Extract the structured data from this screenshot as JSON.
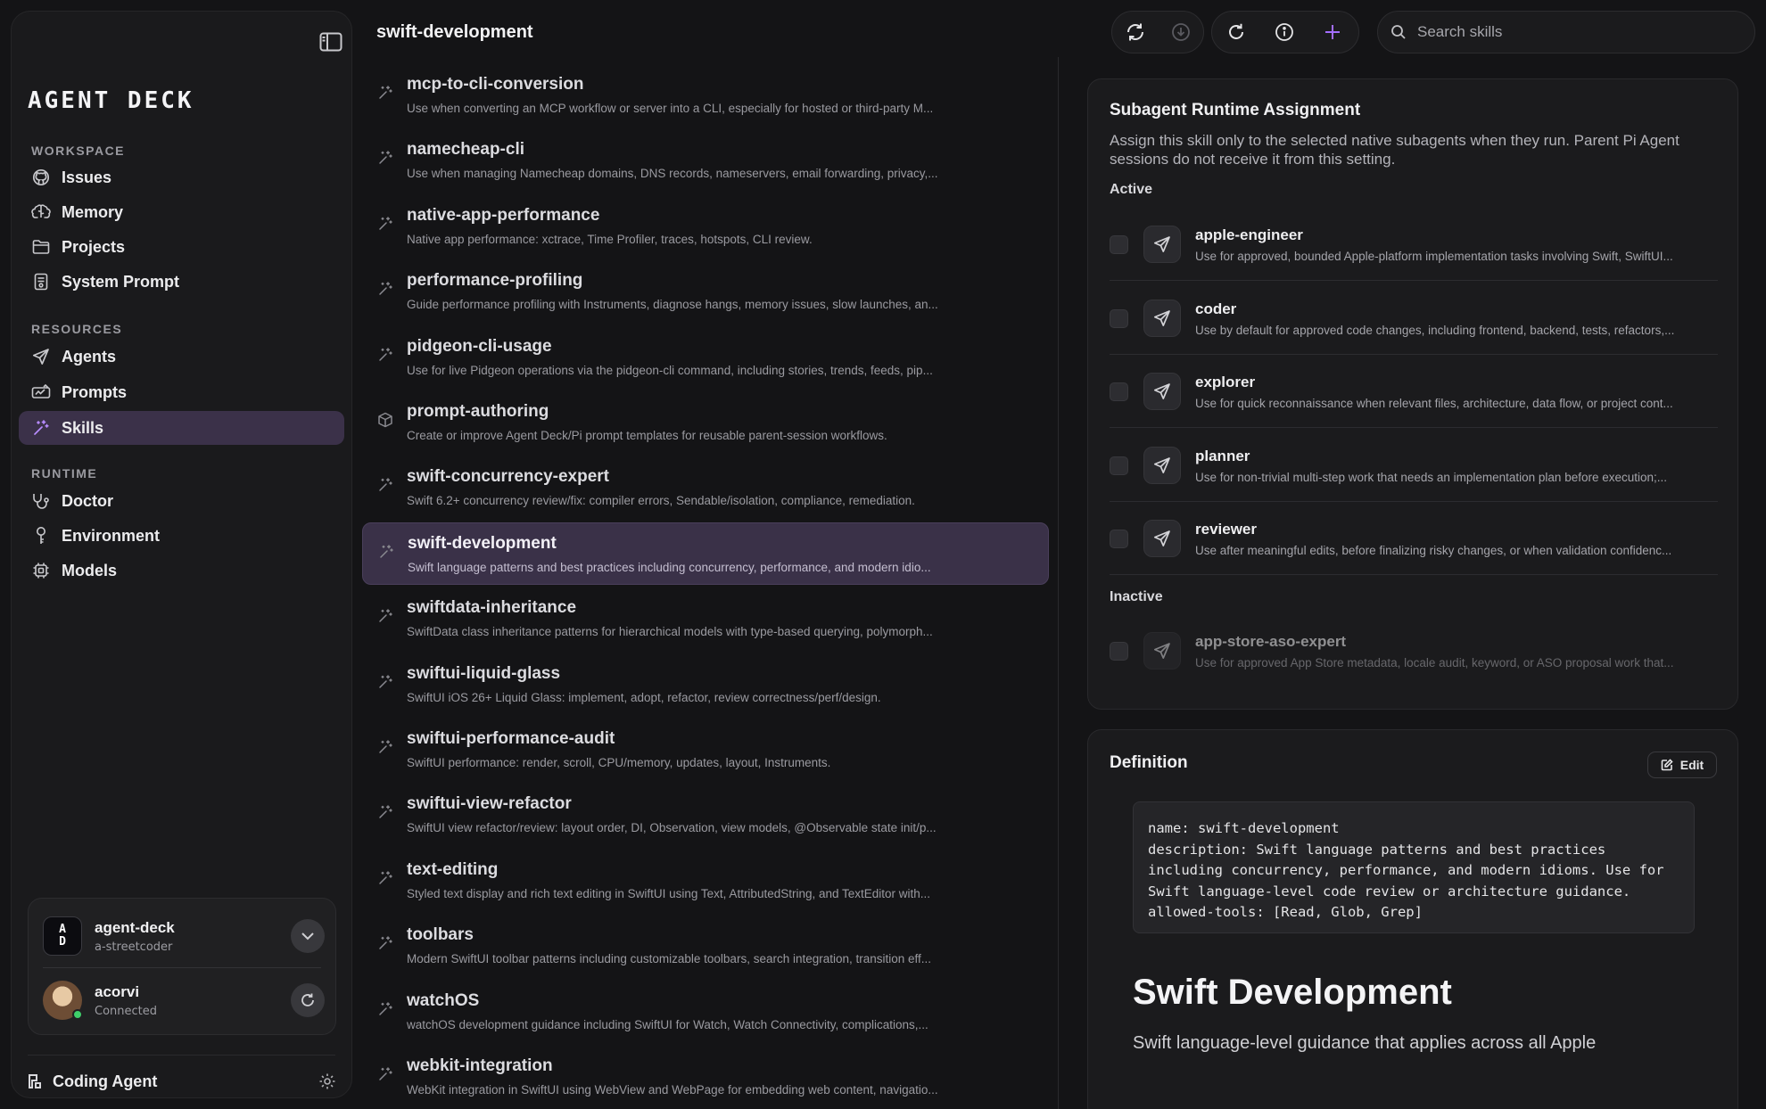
{
  "header": {
    "title": "swift-development"
  },
  "search": {
    "placeholder": "Search skills"
  },
  "sidebar": {
    "logo": "AGENT DECK",
    "sections": [
      {
        "label": "WORKSPACE",
        "items": [
          {
            "label": "Issues",
            "icon": "github-icon"
          },
          {
            "label": "Memory",
            "icon": "brain-icon"
          },
          {
            "label": "Projects",
            "icon": "folder-icon"
          },
          {
            "label": "System Prompt",
            "icon": "document-icon"
          }
        ]
      },
      {
        "label": "RESOURCES",
        "items": [
          {
            "label": "Agents",
            "icon": "send-icon"
          },
          {
            "label": "Prompts",
            "icon": "prompt-icon"
          },
          {
            "label": "Skills",
            "icon": "sparkle-wand-icon",
            "active": true
          }
        ]
      },
      {
        "label": "RUNTIME",
        "items": [
          {
            "label": "Doctor",
            "icon": "stethoscope-icon"
          },
          {
            "label": "Environment",
            "icon": "key-icon"
          },
          {
            "label": "Models",
            "icon": "chip-icon"
          }
        ]
      }
    ],
    "account": {
      "app_name": "agent-deck",
      "app_user": "a-streetcoder",
      "app_badge": "A D",
      "user_name": "acorvi",
      "user_status": "Connected"
    },
    "footer_label": "Coding Agent"
  },
  "skills": [
    {
      "name": "mcp-to-cli-conversion",
      "desc": "Use when converting an MCP workflow or server into a CLI, especially for hosted or third-party M..."
    },
    {
      "name": "namecheap-cli",
      "desc": "Use when managing Namecheap domains, DNS records, nameservers, email forwarding, privacy,..."
    },
    {
      "name": "native-app-performance",
      "desc": "Native app performance: xctrace, Time Profiler, traces, hotspots, CLI review."
    },
    {
      "name": "performance-profiling",
      "desc": "Guide performance profiling with Instruments, diagnose hangs, memory issues, slow launches, an..."
    },
    {
      "name": "pidgeon-cli-usage",
      "desc": "Use for live Pidgeon operations via the pidgeon-cli command, including stories, trends, feeds, pip..."
    },
    {
      "name": "prompt-authoring",
      "desc": "Create or improve Agent Deck/Pi prompt templates for reusable parent-session workflows.",
      "icon": "cube-icon"
    },
    {
      "name": "swift-concurrency-expert",
      "desc": "Swift 6.2+ concurrency review/fix: compiler errors, Sendable/isolation, compliance, remediation."
    },
    {
      "name": "swift-development",
      "desc": "Swift language patterns and best practices including concurrency, performance, and modern idio...",
      "active": true
    },
    {
      "name": "swiftdata-inheritance",
      "desc": "SwiftData class inheritance patterns for hierarchical models with type-based querying, polymorph..."
    },
    {
      "name": "swiftui-liquid-glass",
      "desc": "SwiftUI iOS 26+ Liquid Glass: implement, adopt, refactor, review correctness/perf/design."
    },
    {
      "name": "swiftui-performance-audit",
      "desc": "SwiftUI performance: render, scroll, CPU/memory, updates, layout, Instruments."
    },
    {
      "name": "swiftui-view-refactor",
      "desc": "SwiftUI view refactor/review: layout order, DI, Observation, view models, @Observable state init/p..."
    },
    {
      "name": "text-editing",
      "desc": "Styled text display and rich text editing in SwiftUI using Text, AttributedString, and TextEditor with..."
    },
    {
      "name": "toolbars",
      "desc": "Modern SwiftUI toolbar patterns including customizable toolbars, search integration, transition eff..."
    },
    {
      "name": "watchOS",
      "desc": "watchOS development guidance including SwiftUI for Watch, Watch Connectivity, complications,..."
    },
    {
      "name": "webkit-integration",
      "desc": "WebKit integration in SwiftUI using WebView and WebPage for embedding web content, navigatio..."
    }
  ],
  "runtime": {
    "title": "Subagent Runtime Assignment",
    "description": "Assign this skill only to the selected native subagents when they run. Parent Pi Agent sessions do not receive it from this setting.",
    "active_label": "Active",
    "inactive_label": "Inactive",
    "active": [
      {
        "name": "apple-engineer",
        "desc": "Use for approved, bounded Apple-platform implementation tasks involving Swift, SwiftUI..."
      },
      {
        "name": "coder",
        "desc": "Use by default for approved code changes, including frontend, backend, tests, refactors,..."
      },
      {
        "name": "explorer",
        "desc": "Use for quick reconnaissance when relevant files, architecture, data flow, or project cont..."
      },
      {
        "name": "planner",
        "desc": "Use for non-trivial multi-step work that needs an implementation plan before execution;..."
      },
      {
        "name": "reviewer",
        "desc": "Use after meaningful edits, before finalizing risky changes, or when validation confidenc..."
      }
    ],
    "inactive": [
      {
        "name": "app-store-aso-expert",
        "desc": "Use for approved App Store metadata, locale audit, keyword, or ASO proposal work that..."
      }
    ]
  },
  "definition": {
    "title": "Definition",
    "edit_label": "Edit",
    "code": "name: swift-development\ndescription: Swift language patterns and best practices\nincluding concurrency, performance, and modern idioms. Use for\nSwift language-level code review or architecture guidance.\nallowed-tools: [Read, Glob, Grep]",
    "heading": "Swift Development",
    "paragraph": "Swift language-level guidance that applies across all Apple"
  }
}
